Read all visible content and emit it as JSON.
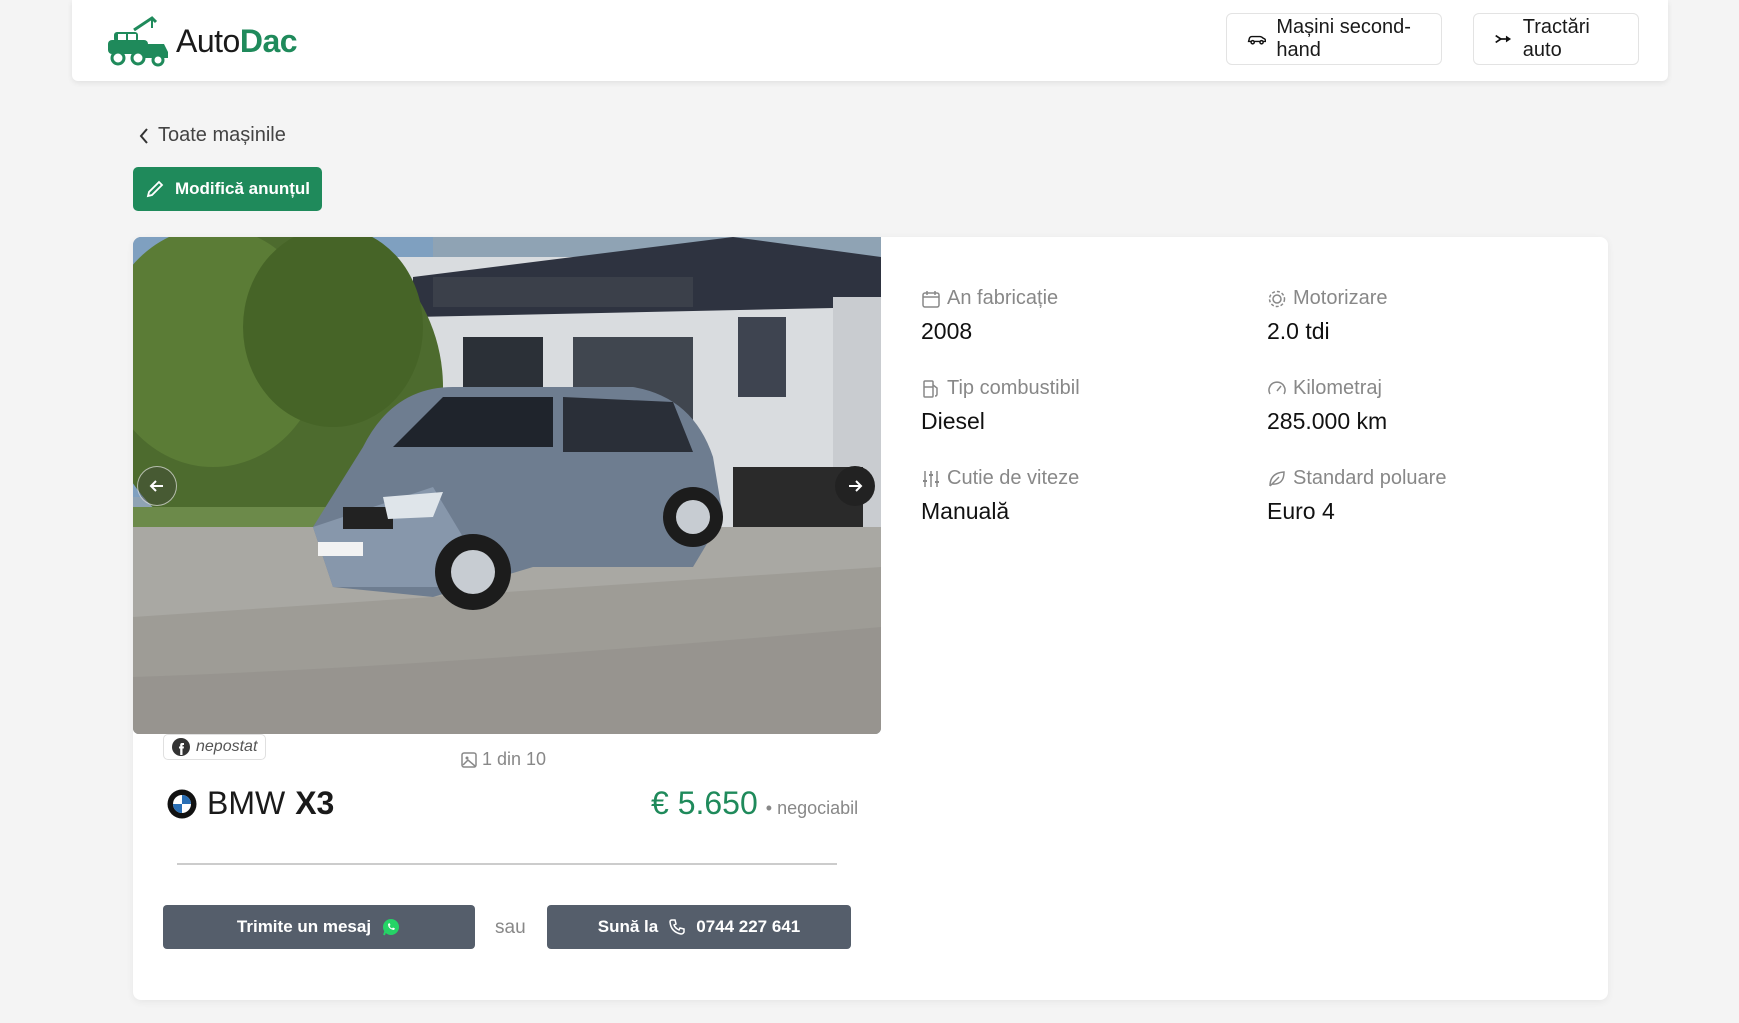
{
  "brand": {
    "name_part1": "Auto",
    "name_part2": "Dac"
  },
  "nav": {
    "used_cars": "Mașini second-hand",
    "towing": "Tractări auto"
  },
  "back_link": "Toate mașinile",
  "edit_button": "Modifică anunțul",
  "gallery": {
    "counter": "1 din 10"
  },
  "facebook_status": "nepostat",
  "listing": {
    "make": "BMW",
    "model": "X3",
    "price": "€ 5.650",
    "price_note": "• negociabil"
  },
  "contact": {
    "message_button": "Trimite un mesaj",
    "or": "sau",
    "call_label": "Sună la",
    "phone": "0744 227 641"
  },
  "specs": {
    "year": {
      "label": "An fabricație",
      "value": "2008",
      "icon": "calendar-icon"
    },
    "engine": {
      "label": "Motorizare",
      "value": "2.0 tdi",
      "icon": "engine-gear-icon"
    },
    "fuel": {
      "label": "Tip combustibil",
      "value": "Diesel",
      "icon": "fuel-pump-icon"
    },
    "mileage": {
      "label": "Kilometraj",
      "value": "285.000 km",
      "icon": "speedometer-icon"
    },
    "gearbox": {
      "label": "Cutie de viteze",
      "value": "Manuală",
      "icon": "sliders-icon"
    },
    "emissions": {
      "label": "Standard poluare",
      "value": "Euro 4",
      "icon": "leaf-icon"
    }
  },
  "colors": {
    "accent": "#1f8a5b",
    "dark_button": "#555e6b",
    "background": "#f4f4f4"
  }
}
